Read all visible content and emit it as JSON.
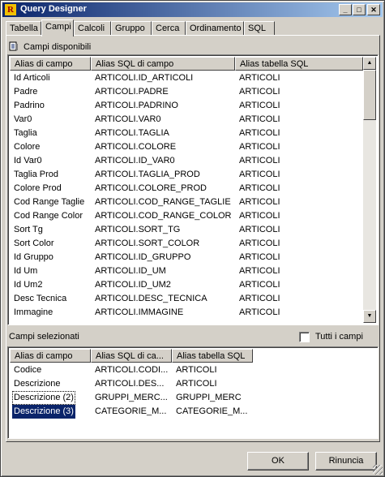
{
  "window": {
    "title": "Query Designer",
    "app_icon_letter": "R"
  },
  "tabs": [
    {
      "label": "Tabella",
      "active": false
    },
    {
      "label": "Campi",
      "active": true
    },
    {
      "label": "Calcoli",
      "active": false
    },
    {
      "label": "Gruppo",
      "active": false
    },
    {
      "label": "Cerca",
      "active": false
    },
    {
      "label": "Ordinamento",
      "active": false
    },
    {
      "label": "SQL",
      "active": false
    }
  ],
  "available": {
    "label": "Campi disponibili",
    "columns": [
      "Alias di campo",
      "Alias SQL di campo",
      "Alias tabella SQL"
    ],
    "rows": [
      [
        "Id Articoli",
        "ARTICOLI.ID_ARTICOLI",
        "ARTICOLI"
      ],
      [
        "Padre",
        "ARTICOLI.PADRE",
        "ARTICOLI"
      ],
      [
        "Padrino",
        "ARTICOLI.PADRINO",
        "ARTICOLI"
      ],
      [
        "Var0",
        "ARTICOLI.VAR0",
        "ARTICOLI"
      ],
      [
        "Taglia",
        "ARTICOLI.TAGLIA",
        "ARTICOLI"
      ],
      [
        "Colore",
        "ARTICOLI.COLORE",
        "ARTICOLI"
      ],
      [
        "Id Var0",
        "ARTICOLI.ID_VAR0",
        "ARTICOLI"
      ],
      [
        "Taglia Prod",
        "ARTICOLI.TAGLIA_PROD",
        "ARTICOLI"
      ],
      [
        "Colore Prod",
        "ARTICOLI.COLORE_PROD",
        "ARTICOLI"
      ],
      [
        "Cod Range Taglie",
        "ARTICOLI.COD_RANGE_TAGLIE",
        "ARTICOLI"
      ],
      [
        "Cod Range Color",
        "ARTICOLI.COD_RANGE_COLOR",
        "ARTICOLI"
      ],
      [
        "Sort Tg",
        "ARTICOLI.SORT_TG",
        "ARTICOLI"
      ],
      [
        "Sort Color",
        "ARTICOLI.SORT_COLOR",
        "ARTICOLI"
      ],
      [
        "Id Gruppo",
        "ARTICOLI.ID_GRUPPO",
        "ARTICOLI"
      ],
      [
        "Id Um",
        "ARTICOLI.ID_UM",
        "ARTICOLI"
      ],
      [
        "Id Um2",
        "ARTICOLI.ID_UM2",
        "ARTICOLI"
      ],
      [
        "Desc Tecnica",
        "ARTICOLI.DESC_TECNICA",
        "ARTICOLI"
      ],
      [
        "Immagine",
        "ARTICOLI.IMMAGINE",
        "ARTICOLI"
      ]
    ]
  },
  "selected": {
    "label": "Campi selezionati",
    "all_fields_label": "Tutti i campi",
    "all_fields_checked": false,
    "columns": [
      "Alias di campo",
      "Alias SQL di ca...",
      "Alias tabella SQL"
    ],
    "rows": [
      [
        "Codice",
        "ARTICOLI.CODI...",
        "ARTICOLI"
      ],
      [
        "Descrizione",
        "ARTICOLI.DES...",
        "ARTICOLI"
      ],
      [
        "Descrizione (2)",
        "GRUPPI_MERC...",
        "GRUPPI_MERC"
      ],
      [
        "Descrizione (3)",
        "CATEGORIE_M...",
        "CATEGORIE_M..."
      ]
    ],
    "focused_row": 2,
    "selected_row": 3
  },
  "buttons": {
    "ok": "OK",
    "cancel": "Rinuncia"
  },
  "colors": {
    "selection": "#0a246a",
    "face": "#d4d0c8"
  }
}
